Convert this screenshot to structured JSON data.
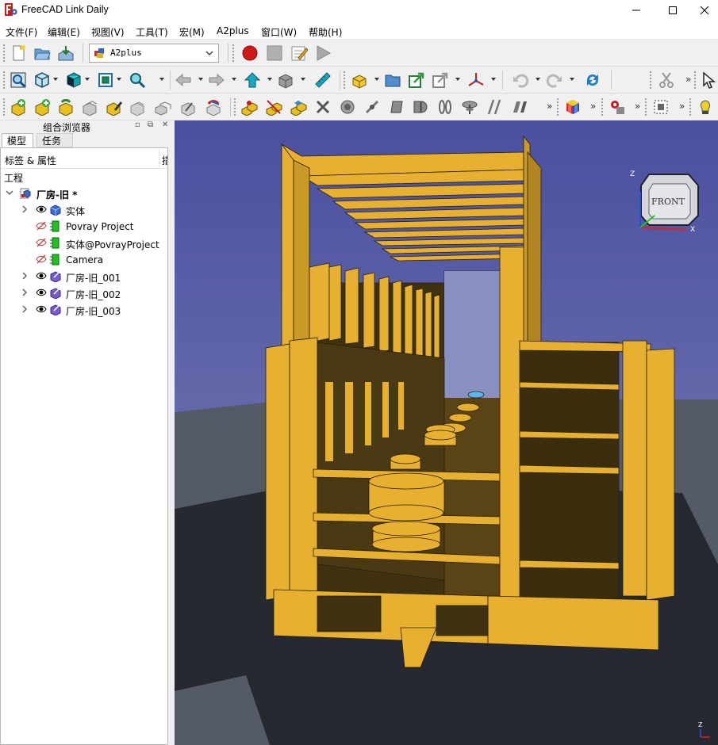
{
  "window": {
    "title": "FreeCAD Link Daily",
    "controls": [
      "minimize-icon",
      "maximize-icon",
      "close-icon"
    ]
  },
  "menubar": {
    "items": [
      "文件(F)",
      "编辑(E)",
      "视图(V)",
      "工具(T)",
      "宏(M)",
      "A2plus",
      "窗口(W)",
      "帮助(H)"
    ]
  },
  "toolbar": {
    "workbench_selected": "A2plus",
    "file_icons": [
      "new-document-icon",
      "open-icon",
      "save-icon"
    ],
    "macro_icons": [
      "record-macro-icon",
      "stop-macro-icon",
      "edit-macro-icon",
      "execute-macro-icon"
    ],
    "view_icons": [
      "fit-all-icon",
      "draw-style-icon",
      "standard-views-icon",
      "bounding-box-icon",
      "zoom-icon",
      "back-arrow-icon",
      "forward-arrow-icon",
      "workbench-up-icon",
      "std-box-icon",
      "measure-icon",
      "part-icon",
      "group-folder-icon",
      "link-icon",
      "link-actions-icon",
      "axis-cross-icon",
      "undo-icon",
      "redo-icon",
      "refresh-icon",
      "cut-icon",
      "select-cursor-icon"
    ],
    "a2plus_icons": [
      "add-part-icon",
      "add-part-alt-icon",
      "update-imports-icon",
      "duplicate-part-icon",
      "edit-part-icon",
      "move-part-icon",
      "duplicate-part-2-icon",
      "convert-part-icon",
      "restore-icon",
      "point-identity-icon",
      "point-on-line-icon",
      "point-on-plane-icon",
      "sphere-constraint-icon",
      "delete-constraint-icon",
      "circular-edge-icon",
      "axis-identity-icon",
      "plane-coincident-icon",
      "angled-planes-icon",
      "axis-parallel-icon",
      "axial-align-icon",
      "plane-parallel-icon",
      "parallel-lines-icon",
      "solver-cube-icon",
      "gear-settings-icon",
      "bom-icon",
      "help-lamp-icon"
    ]
  },
  "combo_view": {
    "title": "组合浏览器",
    "tabs": [
      "模型",
      "任务"
    ],
    "tree_header": "标签 & 属性",
    "tree_header_col2": "描",
    "section": "工程",
    "root": {
      "label": "厂房-旧 *"
    },
    "items": [
      {
        "label": "实体",
        "expandable": true,
        "visible": true,
        "icon": "part-blue-icon"
      },
      {
        "label": "Povray Project",
        "expandable": false,
        "visible": false,
        "icon": "povray-icon"
      },
      {
        "label": "实体@PovrayProject",
        "expandable": false,
        "visible": false,
        "icon": "povray-icon"
      },
      {
        "label": "Camera",
        "expandable": false,
        "visible": false,
        "icon": "camera-icon"
      },
      {
        "label": "厂房-旧_001",
        "expandable": true,
        "visible": true,
        "icon": "part-link-icon"
      },
      {
        "label": "厂房-旧_002",
        "expandable": true,
        "visible": true,
        "icon": "part-link-icon"
      },
      {
        "label": "厂房-旧_003",
        "expandable": true,
        "visible": true,
        "icon": "part-link-icon"
      }
    ]
  },
  "navcube": {
    "face": "FRONT",
    "axes": [
      "Z",
      "X"
    ]
  },
  "colors": {
    "model": "#e8b030",
    "model_shadow": "#3f3210",
    "sky_top": "#4a4fa0",
    "sky_bottom": "#7f86b4",
    "ground": "#555b66",
    "shadow": "#26292f"
  }
}
